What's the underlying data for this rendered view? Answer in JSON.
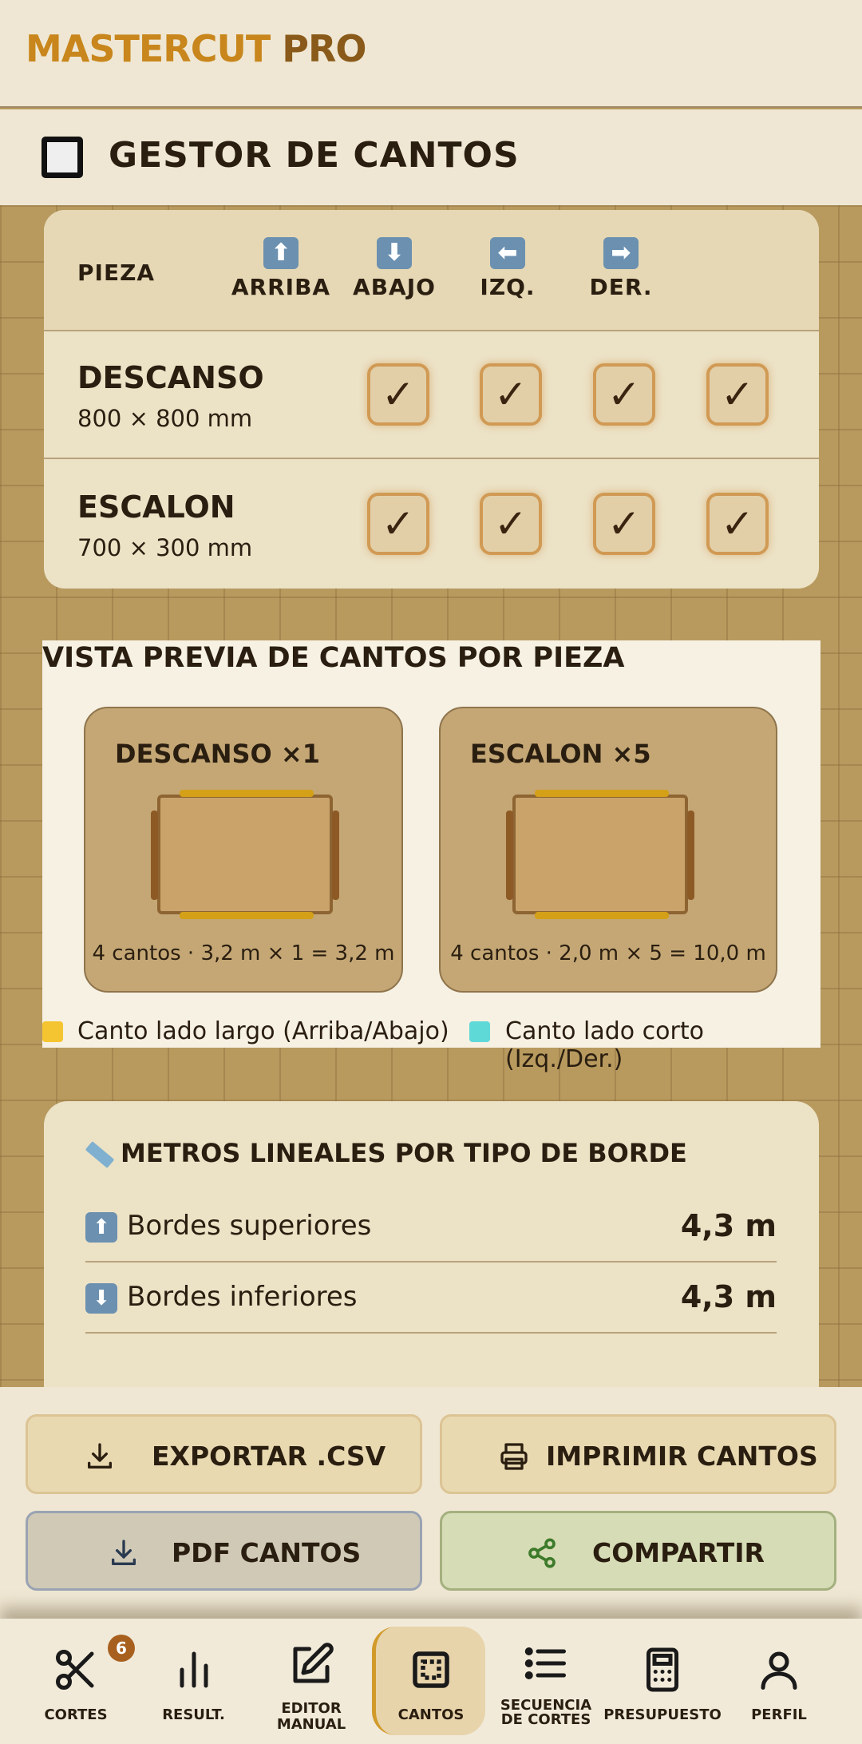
{
  "app": {
    "brand_part1": "MASTERCUT",
    "brand_part2": " PRO"
  },
  "section": {
    "title": "GESTOR DE CANTOS",
    "icon": "stop-square-icon"
  },
  "edge_table": {
    "headers": {
      "piece": "PIEZA",
      "top": "ARRIBA",
      "bottom": "ABAJO",
      "left": "IZQ.",
      "right": "DER."
    },
    "header_icons": {
      "top": "⬆",
      "bottom": "⬇",
      "left": "⬅",
      "right": "➡"
    },
    "rows": [
      {
        "name": "DESCANSO",
        "dims": "800 × 800 mm",
        "top": "✓",
        "bottom": "✓",
        "left": "✓",
        "right": "✓"
      },
      {
        "name": "ESCALON",
        "dims": "700 × 300 mm",
        "top": "✓",
        "bottom": "✓",
        "left": "✓",
        "right": "✓"
      }
    ]
  },
  "preview": {
    "title": "VISTA PREVIA DE CANTOS POR PIEZA",
    "cards": [
      {
        "name": "DESCANSO ×1",
        "info": "4 cantos · 3,2 m × 1 = 3,2 m"
      },
      {
        "name": "ESCALON ×5",
        "info": "4 cantos · 2,0 m × 5 = 10,0 m"
      }
    ],
    "legend": [
      {
        "label": "Canto lado largo (Arriba/Abajo)",
        "color": "#f5c531"
      },
      {
        "label": "Canto lado corto (Izq./Der.)",
        "color": "#5fd8d8"
      }
    ]
  },
  "metros": {
    "title": "METROS LINEALES POR TIPO DE BORDE",
    "rows": [
      {
        "icon": "⬆",
        "label": "Bordes superiores",
        "value": "4,3 m"
      },
      {
        "icon": "⬇",
        "label": "Bordes inferiores",
        "value": "4,3 m"
      }
    ]
  },
  "actions": {
    "export_csv": "EXPORTAR .CSV",
    "print": "IMPRIMIR CANTOS",
    "pdf": "PDF CANTOS",
    "share": "COMPARTIR"
  },
  "nav": {
    "cortes": "CORTES",
    "cortes_badge": "6",
    "result": "RESULT.",
    "editor_1": "EDITOR",
    "editor_2": "MANUAL",
    "cantos": "CANTOS",
    "secuencia_1": "SECUENCIA",
    "secuencia_2": "DE CORTES",
    "presupuesto": "PRESUPUESTO",
    "perfil": "PERFIL"
  }
}
